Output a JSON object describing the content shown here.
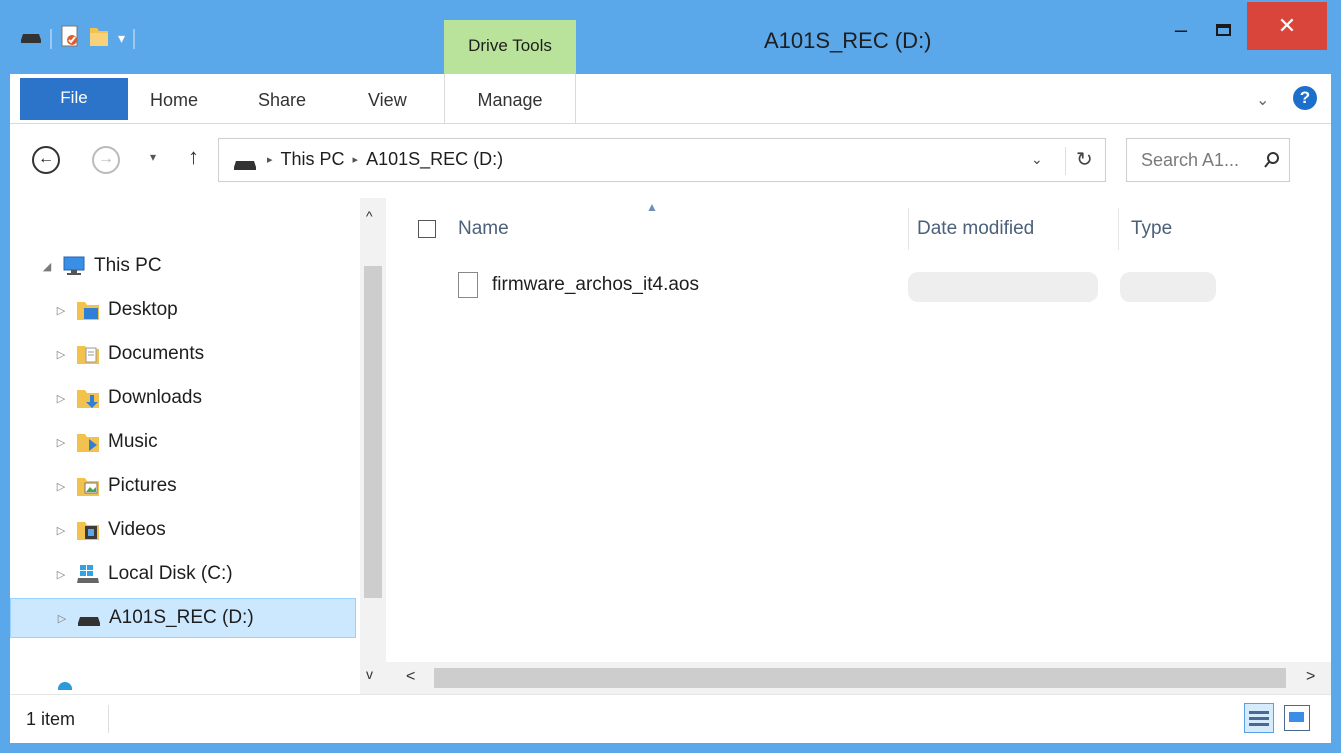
{
  "window": {
    "title": "A101S_REC (D:)",
    "contextual_tab_group": "Drive Tools",
    "controls": {
      "minimize": "–",
      "close": "✕"
    }
  },
  "ribbon": {
    "tabs": [
      {
        "label": "File",
        "active": false
      },
      {
        "label": "Home"
      },
      {
        "label": "Share"
      },
      {
        "label": "View"
      },
      {
        "label": "Manage",
        "contextual": true
      }
    ],
    "collapse_glyph": "⌄",
    "help_glyph": "?"
  },
  "navigation": {
    "back_glyph": "←",
    "forward_glyph": "→",
    "recent_glyph": "▾",
    "up_glyph": "↑",
    "breadcrumb": [
      "This PC",
      "A101S_REC (D:)"
    ],
    "breadcrumb_separator": "▸",
    "dropdown_glyph": "⌄",
    "refresh_glyph": "↻",
    "search_placeholder": "Search A1..."
  },
  "nav_pane": {
    "items": [
      {
        "label": "This PC",
        "icon": "computer-icon",
        "expander": "◢",
        "level": 0
      },
      {
        "label": "Desktop",
        "icon": "desktop-folder-icon",
        "expander": "▷",
        "level": 1
      },
      {
        "label": "Documents",
        "icon": "documents-folder-icon",
        "expander": "▷",
        "level": 1
      },
      {
        "label": "Downloads",
        "icon": "downloads-folder-icon",
        "expander": "▷",
        "level": 1
      },
      {
        "label": "Music",
        "icon": "music-folder-icon",
        "expander": "▷",
        "level": 1
      },
      {
        "label": "Pictures",
        "icon": "pictures-folder-icon",
        "expander": "▷",
        "level": 1
      },
      {
        "label": "Videos",
        "icon": "videos-folder-icon",
        "expander": "▷",
        "level": 1
      },
      {
        "label": "Local Disk (C:)",
        "icon": "windows-drive-icon",
        "expander": "▷",
        "level": 1
      },
      {
        "label": "A101S_REC (D:)",
        "icon": "removable-drive-icon",
        "expander": "▷",
        "level": 1,
        "selected": true
      }
    ],
    "scroll_up_glyph": "^",
    "scroll_down_glyph": "v"
  },
  "file_list": {
    "columns": [
      "Name",
      "Date modified",
      "Type"
    ],
    "sort_glyph": "▲",
    "rows": [
      {
        "name": "firmware_archos_it4.aos"
      }
    ],
    "hscroll_left_glyph": "<",
    "hscroll_right_glyph": ">"
  },
  "status": {
    "item_count": "1 item"
  },
  "colors": {
    "titlebar": "#5aa7ea",
    "drive_tools_tab": "#b9e39a",
    "file_tab": "#2c74c9",
    "close_button": "#d9453a",
    "selection": "#cce8ff"
  }
}
